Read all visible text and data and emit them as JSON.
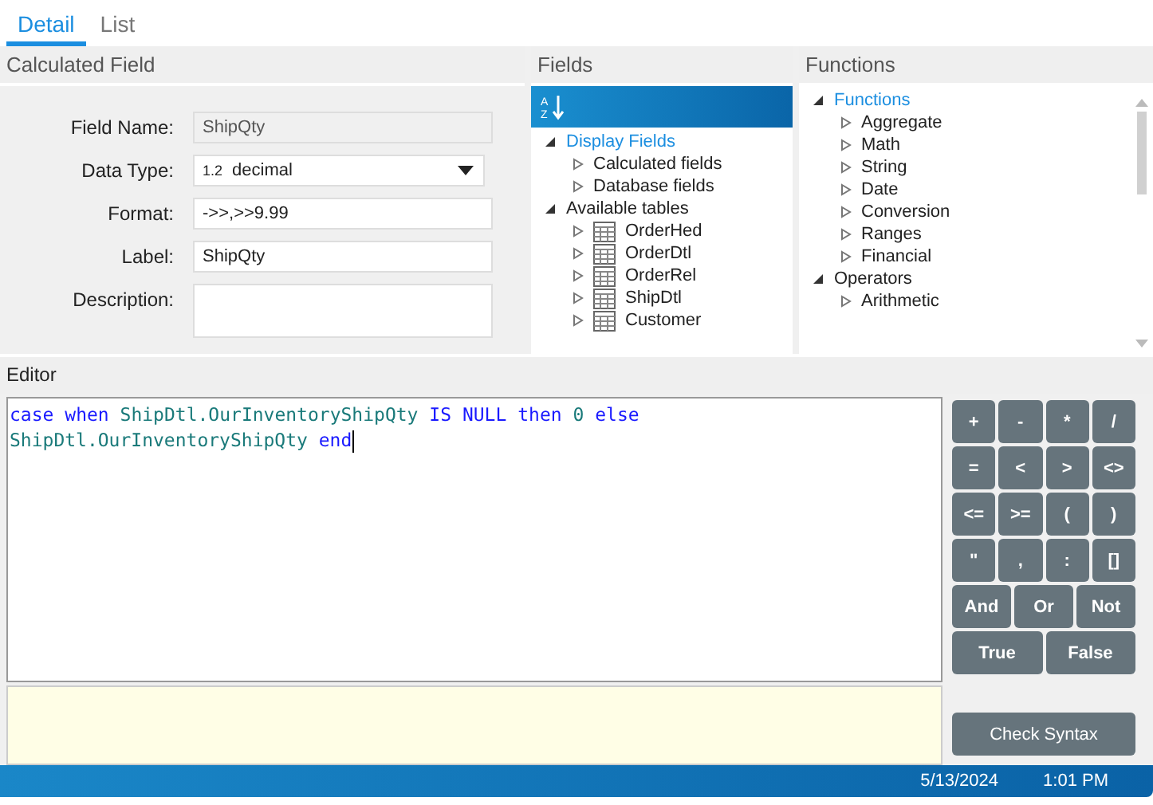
{
  "tabs": [
    {
      "label": "Detail",
      "selected": true
    },
    {
      "label": "List",
      "selected": false
    }
  ],
  "calculated_field": {
    "title": "Calculated Field",
    "rows": [
      {
        "label": "Field Name:",
        "kind": "readonly",
        "value": "ShipQty"
      },
      {
        "label": "Data Type:",
        "kind": "dropdown",
        "prefix": "1.2",
        "value": "decimal"
      },
      {
        "label": "Format:",
        "kind": "text",
        "value": "->>,>>9.99"
      },
      {
        "label": "Label:",
        "kind": "text",
        "value": "ShipQty"
      },
      {
        "label": "Description:",
        "kind": "textarea",
        "value": ""
      }
    ]
  },
  "fields": {
    "title": "Fields",
    "sort_icon_label": "A Z",
    "tree": [
      {
        "label": "Display Fields",
        "expanded": true,
        "selected": true,
        "children": [
          {
            "label": "Calculated fields",
            "expanded": false,
            "selected": false,
            "kind": "folder"
          },
          {
            "label": "Database fields",
            "expanded": false,
            "selected": false,
            "kind": "folder"
          }
        ]
      },
      {
        "label": "Available tables",
        "expanded": true,
        "selected": false,
        "children": [
          {
            "label": "OrderHed",
            "expanded": false,
            "selected": false,
            "kind": "table"
          },
          {
            "label": "OrderDtl",
            "expanded": false,
            "selected": false,
            "kind": "table"
          },
          {
            "label": "OrderRel",
            "expanded": false,
            "selected": false,
            "kind": "table"
          },
          {
            "label": "ShipDtl",
            "expanded": false,
            "selected": false,
            "kind": "table"
          },
          {
            "label": "Customer",
            "expanded": false,
            "selected": false,
            "kind": "table"
          }
        ]
      }
    ]
  },
  "functions": {
    "title": "Functions",
    "tree": [
      {
        "label": "Functions",
        "expanded": true,
        "selected": true,
        "children": [
          {
            "label": "Aggregate",
            "expanded": false,
            "selected": false
          },
          {
            "label": "Math",
            "expanded": false,
            "selected": false
          },
          {
            "label": "String",
            "expanded": false,
            "selected": false
          },
          {
            "label": "Date",
            "expanded": false,
            "selected": false
          },
          {
            "label": "Conversion",
            "expanded": false,
            "selected": false
          },
          {
            "label": "Ranges",
            "expanded": false,
            "selected": false
          },
          {
            "label": "Financial",
            "expanded": false,
            "selected": false
          }
        ]
      },
      {
        "label": "Operators",
        "expanded": true,
        "selected": false,
        "children": [
          {
            "label": "Arithmetic",
            "expanded": false,
            "selected": false
          }
        ]
      }
    ]
  },
  "editor": {
    "title": "Editor",
    "lines": [
      [
        {
          "text": "case",
          "kind": "keyword"
        },
        {
          "text": "when",
          "kind": "keyword"
        },
        {
          "text": "ShipDtl.OurInventoryShipQty",
          "kind": "identifier"
        },
        {
          "text": "IS",
          "kind": "keyword"
        },
        {
          "text": "NULL",
          "kind": "keyword"
        },
        {
          "text": "then",
          "kind": "keyword"
        },
        {
          "text": "0",
          "kind": "number"
        },
        {
          "text": "else",
          "kind": "keyword"
        }
      ],
      [
        {
          "text": "ShipDtl.OurInventoryShipQty",
          "kind": "identifier"
        },
        {
          "text": "end",
          "kind": "keyword"
        }
      ]
    ]
  },
  "keypad": {
    "symbol_rows": [
      [
        "+",
        "-",
        "*",
        "/"
      ],
      [
        "=",
        "<",
        ">",
        "<>"
      ],
      [
        "<=",
        ">=",
        "(",
        ")"
      ],
      [
        "\"",
        ",",
        ":",
        "[]"
      ]
    ],
    "logic_keys": [
      "And",
      "Or",
      "Not"
    ],
    "boolean_keys": [
      "True",
      "False"
    ],
    "check_button": "Check Syntax"
  },
  "status_bar": {
    "date": "5/13/2024",
    "time": "1:01 PM"
  }
}
